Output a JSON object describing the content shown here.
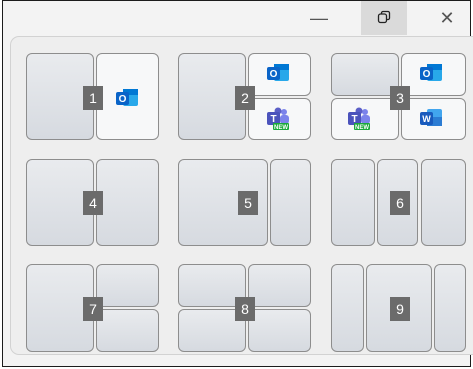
{
  "window": {
    "controls": {
      "minimize": "—",
      "restore": "⧉",
      "close": "✕"
    }
  },
  "snap_layouts": {
    "layout_numbers": [
      "1",
      "2",
      "3",
      "4",
      "5",
      "6",
      "7",
      "8",
      "9"
    ],
    "app_icons": {
      "outlook": {
        "name": "outlook-icon",
        "letter": "O",
        "color": "#0a64c8"
      },
      "teams": {
        "name": "teams-new-icon",
        "letter": "T",
        "color": "#5b5fc7",
        "badge": "NEW"
      },
      "word": {
        "name": "word-icon",
        "letter": "W",
        "color": "#185abd"
      }
    }
  }
}
